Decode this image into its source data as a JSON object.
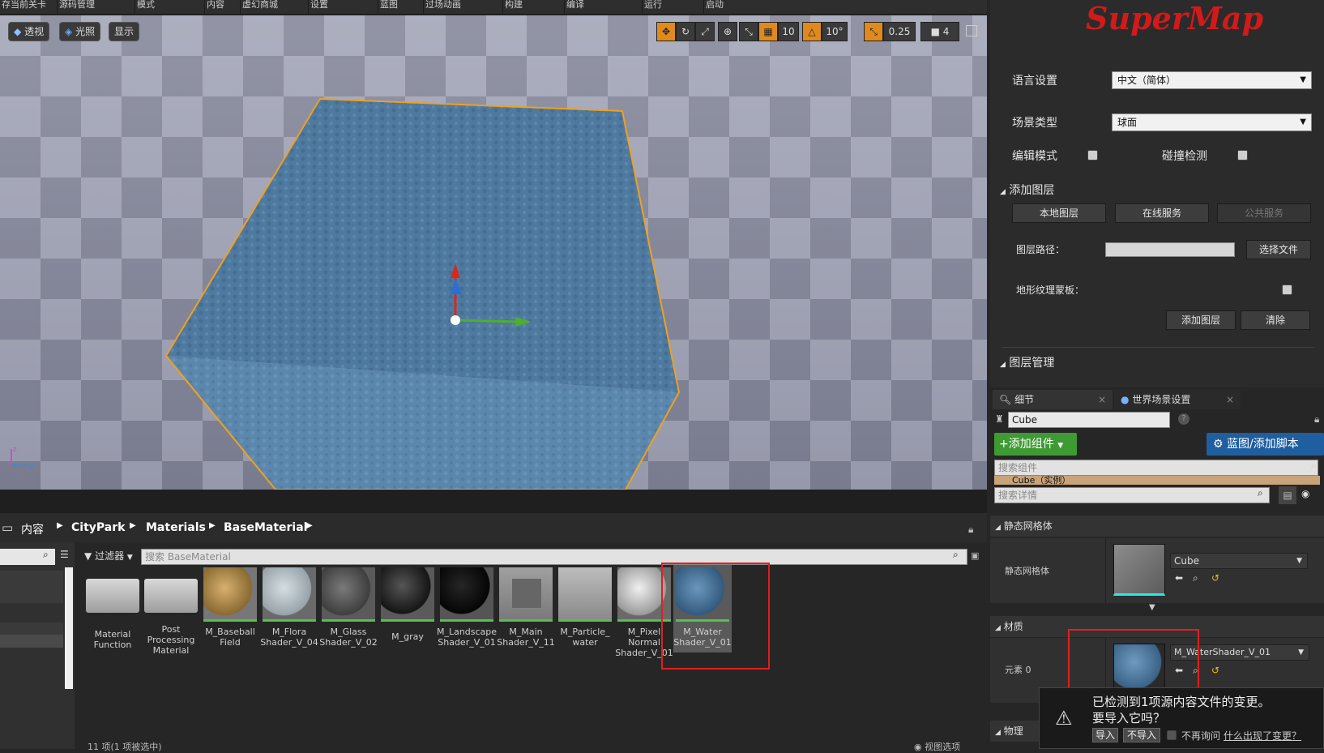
{
  "menubar": [
    "存当前关卡",
    "源码管理",
    "模式",
    "内容",
    "虚幻商城",
    "设置",
    "蓝图",
    "过场动画",
    "构建",
    "编译",
    "运行",
    "启动"
  ],
  "viewport": {
    "btn_perspective": "透视",
    "btn_lit": "光照",
    "btn_show": "显示",
    "grid_snap": "10",
    "rot_snap": "10°",
    "scale_snap": "0.25",
    "cam_speed": "4"
  },
  "right_panel": {
    "logo": "SuperMap",
    "lang_label": "语言设置",
    "lang_value": "中文（简体）",
    "scene_label": "场景类型",
    "scene_value": "球面",
    "edit_mode": "编辑模式",
    "collision": "碰撞检测",
    "add_layer_section": "添加图层",
    "tab_local": "本地图层",
    "tab_online": "在线服务",
    "tab_public": "公共服务",
    "layer_path_label": "图层路径：",
    "choose_file": "选择文件",
    "terrain_mask": "地形纹理蒙板：",
    "add_layer_btn": "添加图层",
    "clear_btn": "清除",
    "layer_mgmt_section": "图层管理"
  },
  "details": {
    "tab_details": "细节",
    "tab_world": "世界场景设置",
    "object_name": "Cube",
    "add_component": "+添加组件",
    "blueprint_btn": "蓝图/添加脚本",
    "search_components": "搜索组件",
    "instance_row": "Cube（实例）",
    "search_details": "搜索详情",
    "sm_section": "静态网格体",
    "sm_label": "静态网格体",
    "sm_value": "Cube",
    "mat_section": "材质",
    "element0": "元素 0",
    "mat_value": "M_WaterShader_V_01",
    "physics_section": "物理"
  },
  "toast": {
    "line1": "已检测到1项源内容文件的变更。",
    "line2": "要导入它吗？",
    "import": "导入",
    "no_import": "不导入",
    "dont_ask": "不再询问",
    "why": "什么出现了变更？"
  },
  "content_browser": {
    "breadcrumb": [
      "内容",
      "CityPark",
      "Materials",
      "BaseMaterial"
    ],
    "filter_label": "过滤器",
    "search_placeholder": "搜索 BaseMaterial",
    "status": "11 项(1 项被选中)",
    "view_options": "视图选项",
    "assets": [
      {
        "name": "Material Function"
      },
      {
        "name": "Post Processing Material"
      },
      {
        "name": "M_Baseball Field"
      },
      {
        "name": "M_Flora Shader_V_04"
      },
      {
        "name": "M_Glass Shader_V_02"
      },
      {
        "name": "M_gray"
      },
      {
        "name": "M_Landscape Shader_V_01"
      },
      {
        "name": "M_Main Shader_V_11"
      },
      {
        "name": "M_Particle_ water"
      },
      {
        "name": "M_Pixel Normal Shader_V_01"
      },
      {
        "name": "M_Water Shader_V_01"
      }
    ]
  }
}
